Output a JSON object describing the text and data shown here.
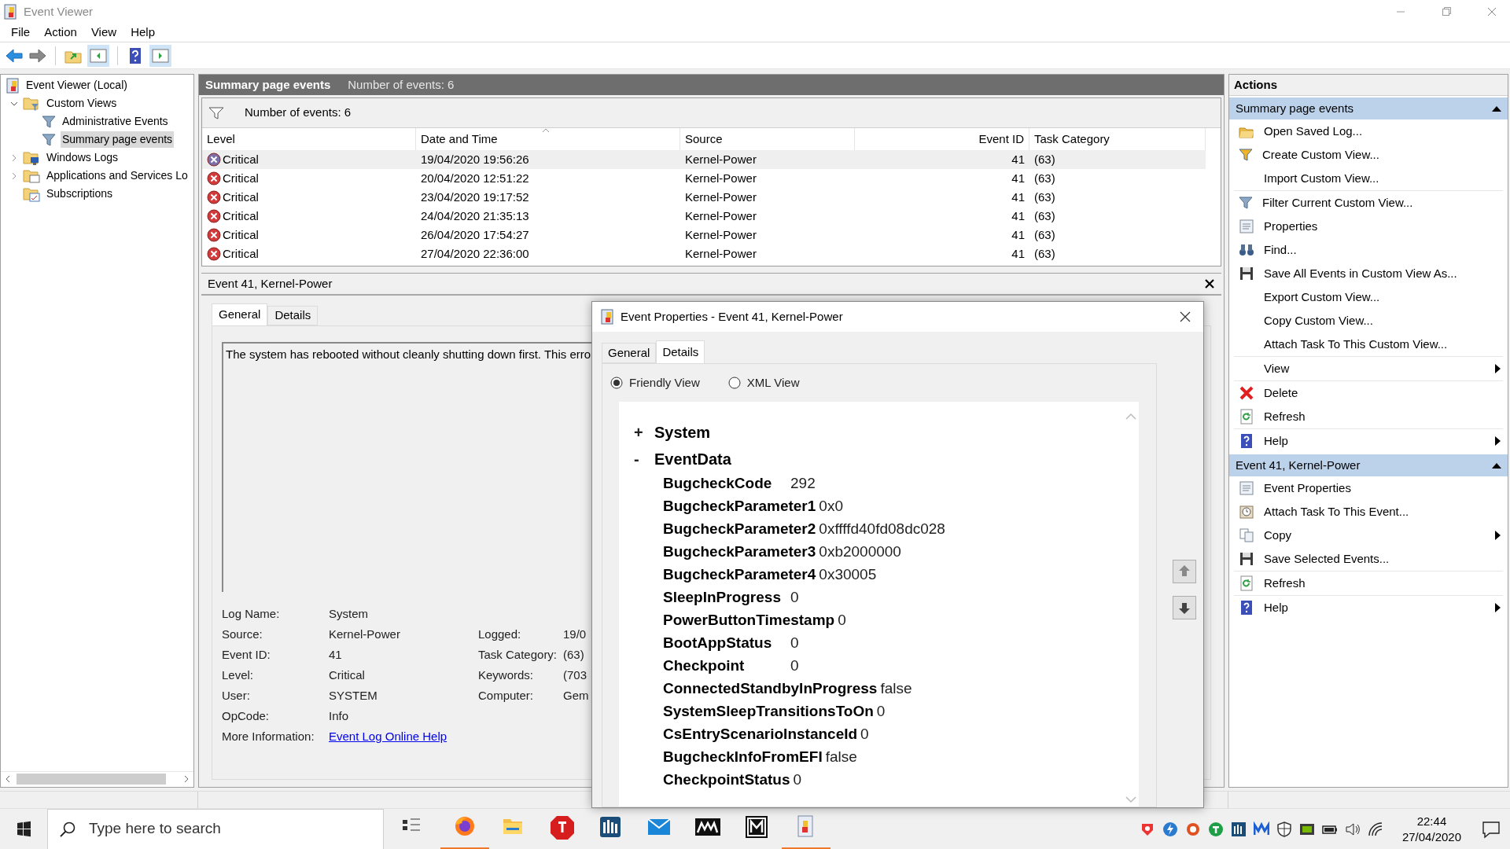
{
  "window": {
    "title": "Event Viewer"
  },
  "menu": [
    "File",
    "Action",
    "View",
    "Help"
  ],
  "tree": [
    {
      "label": "Event Viewer (Local)",
      "selected": false,
      "children": [
        {
          "label": "Custom Views",
          "expanded": true,
          "selected": false,
          "children": [
            {
              "label": "Administrative Events",
              "selected": false
            },
            {
              "label": "Summary page events",
              "selected": true
            }
          ]
        },
        {
          "label": "Windows Logs",
          "expanded": false,
          "selected": false
        },
        {
          "label": "Applications and Services Lo",
          "expanded": false,
          "selected": false
        },
        {
          "label": "Subscriptions",
          "selected": false
        }
      ]
    }
  ],
  "view_header": {
    "title": "Summary page events",
    "count": "Number of events: 6"
  },
  "filter_bar": {
    "text": "Number of events: 6"
  },
  "table": {
    "columns": [
      {
        "label": "Level",
        "sorted": false
      },
      {
        "label": "Date and Time",
        "sorted": true
      },
      {
        "label": "Source",
        "sorted": false
      },
      {
        "label": "Event ID",
        "sorted": false
      },
      {
        "label": "Task Category",
        "sorted": false
      }
    ],
    "rows": [
      {
        "level": "Critical",
        "date": "19/04/2020 19:56:26",
        "source": "Kernel-Power",
        "event_id": "41",
        "task_category": "(63)",
        "selected": true
      },
      {
        "level": "Critical",
        "date": "20/04/2020 12:51:22",
        "source": "Kernel-Power",
        "event_id": "41",
        "task_category": "(63)",
        "selected": false
      },
      {
        "level": "Critical",
        "date": "23/04/2020 19:17:52",
        "source": "Kernel-Power",
        "event_id": "41",
        "task_category": "(63)",
        "selected": false
      },
      {
        "level": "Critical",
        "date": "24/04/2020 21:35:13",
        "source": "Kernel-Power",
        "event_id": "41",
        "task_category": "(63)",
        "selected": false
      },
      {
        "level": "Critical",
        "date": "26/04/2020 17:54:27",
        "source": "Kernel-Power",
        "event_id": "41",
        "task_category": "(63)",
        "selected": false
      },
      {
        "level": "Critical",
        "date": "27/04/2020 22:36:00",
        "source": "Kernel-Power",
        "event_id": "41",
        "task_category": "(63)",
        "selected": false
      }
    ]
  },
  "event_pane": {
    "title": "Event 41, Kernel-Power",
    "tabs": [
      {
        "label": "General",
        "selected": true
      },
      {
        "label": "Details",
        "selected": false
      }
    ],
    "message": "The system has rebooted without cleanly shutting down first. This erro",
    "properties": [
      {
        "label": "Log Name:",
        "value": "System"
      },
      {
        "label": "Source:",
        "value": "Kernel-Power",
        "label2": "Logged:",
        "value2": "19/0"
      },
      {
        "label": "Event ID:",
        "value": "41",
        "label2": "Task Category:",
        "value2": "(63)"
      },
      {
        "label": "Level:",
        "value": "Critical",
        "label2": "Keywords:",
        "value2": "(703"
      },
      {
        "label": "User:",
        "value": "SYSTEM",
        "label2": "Computer:",
        "value2": "Gem"
      },
      {
        "label": "OpCode:",
        "value": "Info"
      }
    ],
    "more_info": {
      "label": "More Information:",
      "link": "Event Log Online Help"
    }
  },
  "dialog": {
    "title": "Event Properties - Event 41, Kernel-Power",
    "tabs": [
      {
        "label": "General",
        "selected": false
      },
      {
        "label": "Details",
        "selected": true
      }
    ],
    "views": [
      {
        "label": "Friendly View",
        "selected": true
      },
      {
        "label": "XML View",
        "selected": false
      }
    ],
    "tree": [
      {
        "toggle": "+",
        "label": "System"
      },
      {
        "toggle": "-",
        "label": "EventData",
        "fields": [
          {
            "name": "BugcheckCode",
            "value": "292"
          },
          {
            "name": "BugcheckParameter1",
            "value": "0x0"
          },
          {
            "name": "BugcheckParameter2",
            "value": "0xffffd40fd08dc028"
          },
          {
            "name": "BugcheckParameter3",
            "value": "0xb2000000"
          },
          {
            "name": "BugcheckParameter4",
            "value": "0x30005"
          },
          {
            "name": "SleepInProgress",
            "value": "0"
          },
          {
            "name": "PowerButtonTimestamp",
            "value": "0"
          },
          {
            "name": "BootAppStatus",
            "value": "0"
          },
          {
            "name": "Checkpoint",
            "value": "0"
          },
          {
            "name": "ConnectedStandbyInProgress",
            "value": "false"
          },
          {
            "name": "SystemSleepTransitionsToOn",
            "value": "0"
          },
          {
            "name": "CsEntryScenarioInstanceId",
            "value": "0"
          },
          {
            "name": "BugcheckInfoFromEFI",
            "value": "false"
          },
          {
            "name": "CheckpointStatus",
            "value": "0"
          }
        ]
      }
    ]
  },
  "actions": {
    "title": "Actions",
    "sections": [
      {
        "title": "Summary page events",
        "expanded": true,
        "groups": [
          [
            {
              "label": "Open Saved Log...",
              "submenu": false
            },
            {
              "label": "Create Custom View...",
              "submenu": false
            },
            {
              "label": "Import Custom View...",
              "submenu": false
            }
          ],
          [
            {
              "label": "Filter Current Custom View...",
              "submenu": false
            },
            {
              "label": "Properties",
              "submenu": false
            },
            {
              "label": "Find...",
              "submenu": false
            },
            {
              "label": "Save All Events in Custom View As...",
              "submenu": false
            },
            {
              "label": "Export Custom View...",
              "submenu": false
            },
            {
              "label": "Copy Custom View...",
              "submenu": false
            },
            {
              "label": "Attach Task To This Custom View...",
              "submenu": false
            }
          ],
          [
            {
              "label": "View",
              "submenu": true
            }
          ],
          [
            {
              "label": "Delete",
              "submenu": false
            },
            {
              "label": "Refresh",
              "submenu": false
            }
          ],
          [
            {
              "label": "Help",
              "submenu": true
            }
          ]
        ]
      },
      {
        "title": "Event 41, Kernel-Power",
        "expanded": true,
        "groups": [
          [
            {
              "label": "Event Properties",
              "submenu": false
            },
            {
              "label": "Attach Task To This Event...",
              "submenu": false
            },
            {
              "label": "Copy",
              "submenu": true
            },
            {
              "label": "Save Selected Events...",
              "submenu": false
            }
          ],
          [
            {
              "label": "Refresh",
              "submenu": false
            }
          ],
          [
            {
              "label": "Help",
              "submenu": true
            }
          ]
        ]
      }
    ]
  },
  "taskbar": {
    "search_placeholder": "Type here to search",
    "apps": [
      {
        "running": false
      },
      {
        "running": true
      },
      {
        "running": false
      },
      {
        "running": false
      },
      {
        "running": false
      },
      {
        "running": false
      },
      {
        "running": false
      },
      {
        "running": false
      },
      {
        "running": true
      }
    ],
    "time": "22:44",
    "date": "27/04/2020"
  }
}
